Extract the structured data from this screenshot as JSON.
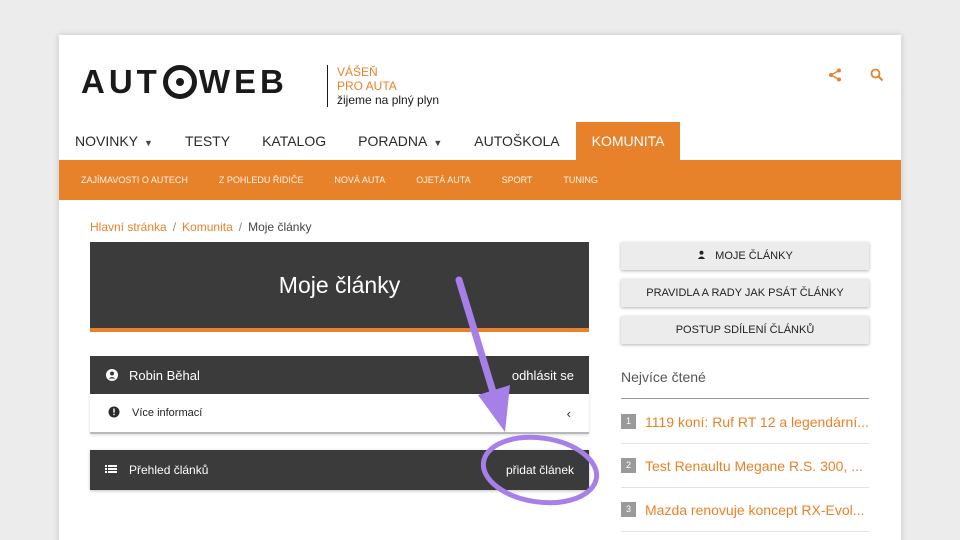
{
  "brand": {
    "logo_text_left": "AUT",
    "logo_text_right": "WEB",
    "tagline_line1": "VÁŠEŇ",
    "tagline_line2": "PRO AUTA",
    "tagline_line3": "žijeme na plný plyn",
    "accent_color": "#e8822a",
    "dark_color": "#3b3b3b"
  },
  "header_icons": [
    "share-icon",
    "search-icon"
  ],
  "main_nav": [
    {
      "label": "NOVINKY",
      "dropdown": true
    },
    {
      "label": "TESTY",
      "dropdown": false
    },
    {
      "label": "KATALOG",
      "dropdown": false
    },
    {
      "label": "PORADNA",
      "dropdown": true
    },
    {
      "label": "AUTOŠKOLA",
      "dropdown": false
    },
    {
      "label": "KOMUNITA",
      "dropdown": false,
      "active": true
    }
  ],
  "sub_nav": [
    "ZAJÍMAVOSTI O AUTECH",
    "Z POHLEDU ŘIDIČE",
    "NOVÁ AUTA",
    "OJETÁ AUTA",
    "SPORT",
    "TUNING"
  ],
  "breadcrumb": {
    "home": "Hlavní stránka",
    "section": "Komunita",
    "current": "Moje články",
    "separator": "/"
  },
  "hero": {
    "title": "Moje články"
  },
  "user_panel": {
    "name": "Robin Běhal",
    "logout_label": "odhlásit se",
    "info_label": "Více informací",
    "articles_label": "Přehled článků",
    "add_article_label": "přidat článek"
  },
  "sidebar": {
    "buttons": [
      "MOJE ČLÁNKY",
      "PRAVIDLA A RADY JAK PSÁT ČLÁNKY",
      "POSTUP SDÍLENÍ ČLÁNKŮ"
    ],
    "popular_title": "Nejvíce čtené",
    "popular": [
      {
        "rank": "1",
        "title": "1119 koní: Ruf RT 12 a legendární..."
      },
      {
        "rank": "2",
        "title": "Test Renaultu Megane R.S. 300, ..."
      },
      {
        "rank": "3",
        "title": "Mazda renovuje koncept RX-Evol..."
      }
    ]
  },
  "annotation": {
    "color": "#a77fe8"
  }
}
